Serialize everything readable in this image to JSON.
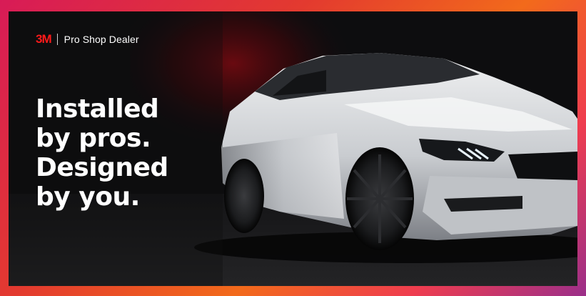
{
  "brand": {
    "logo_text": "3M",
    "name": "Pro Shop Dealer",
    "logo_color": "#ff1a1a"
  },
  "headline": {
    "line1": "Installed",
    "line2": "by pros.",
    "line3": "Designed",
    "line4": "by you."
  },
  "colors": {
    "frame_gradient": [
      "#d81b57",
      "#f26a1b",
      "#9b2f8a"
    ],
    "background": "#0d0d0f",
    "car_body": "#d9dcdf"
  }
}
